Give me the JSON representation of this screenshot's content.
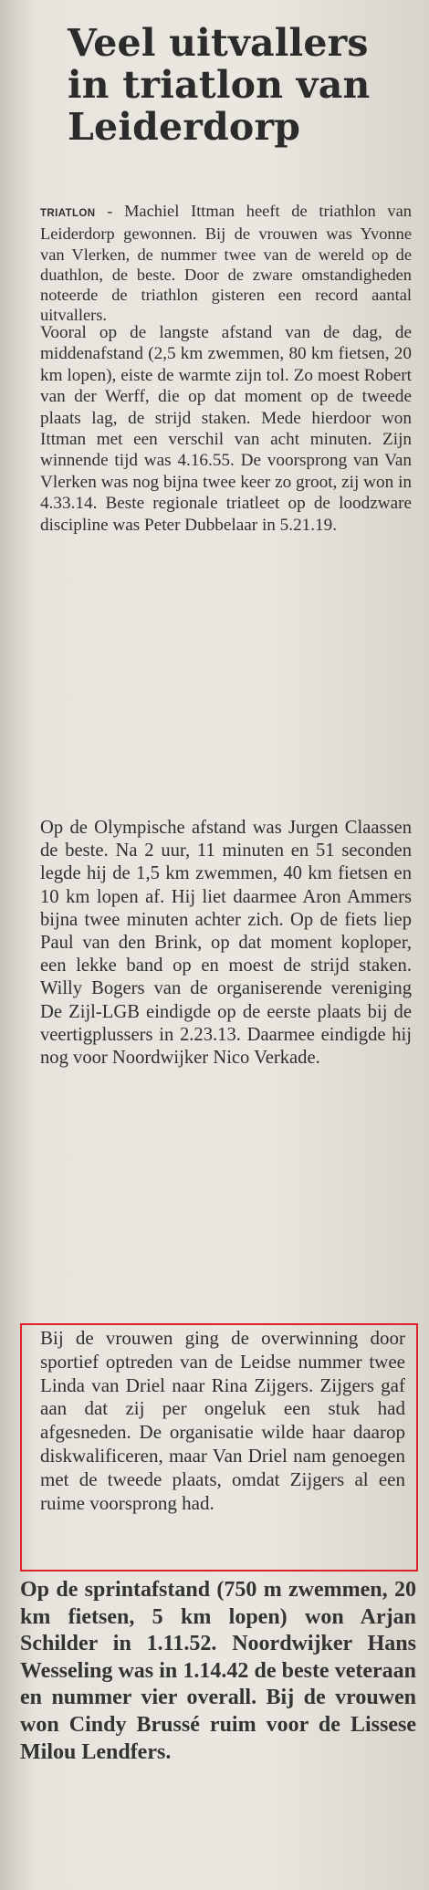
{
  "article": {
    "headline": [
      "Veel uitvallers",
      "in triatlon van",
      "Leiderdorp"
    ],
    "kicker": "TRIATLON",
    "intro_dash": " - ",
    "intro": "Machiel Ittman heeft de triathlon van Leiderdorp gewonnen. Bij de vrouwen was Yvonne van Vlerken, de nummer twee van de wereld op de duathlon, de beste. Door de zware omstandigheden noteerde de triathlon gisteren een record aantal uitvallers.",
    "paragraph_2": "Vooral op de langste afstand van de dag, de middenafstand (2,5 km zwemmen, 80 km fietsen, 20 km lopen), eiste de warmte zijn tol. Zo moest Robert van der Werff, die op dat moment op de tweede plaats lag, de strijd staken. Mede hierdoor won Ittman met een verschil van acht minuten. Zijn winnende tijd was 4.16.55. De voorsprong van Van Vlerken was nog bijna twee keer zo groot, zij won in 4.33.14. Beste regionale triatleet op de loodzware discipline was Peter Dubbelaar in 5.21.19.",
    "paragraph_3": "Op de Olympische afstand was Jurgen Claassen de beste. Na 2 uur, 11 minuten en 51 seconden legde hij de 1,5 km zwemmen, 40 km fietsen en 10 km lopen af. Hij liet daarmee Aron Ammers bijna twee minuten achter zich. Op de fiets liep Paul van den Brink, op dat moment koploper, een lekke band op en moest de strijd staken. Willy Bogers van de organiserende vereniging De Zijl-LGB eindigde op de eerste plaats bij de veertigplussers in 2.23.13. Daarmee eindigde hij nog voor Noordwijker Nico Verkade.",
    "paragraph_4_highlighted": "Bij de vrouwen ging de overwinning door sportief optreden van de Leidse nummer twee Linda van Driel naar Rina Zijgers. Zijgers gaf aan dat zij per ongeluk een stuk had afgesneden. De organisatie wilde haar daarop diskwalificeren, maar Van Driel nam genoegen met de tweede plaats, omdat Zijgers al een ruime voorsprong had.",
    "paragraph_5": "Op de sprintafstand (750 m zwemmen, 20 km fietsen, 5 km lopen) won Arjan Schilder in 1.11.52. Noordwijker Hans Wesseling was in 1.14.42 de beste veteraan en nummer vier overall. Bij de vrouwen won Cindy Brussé ruim voor de Lissese Milou Lendfers."
  },
  "colors": {
    "highlight_border": "#e0202a",
    "paper": "#e7e4dd",
    "ink": "#2a2a2a"
  }
}
